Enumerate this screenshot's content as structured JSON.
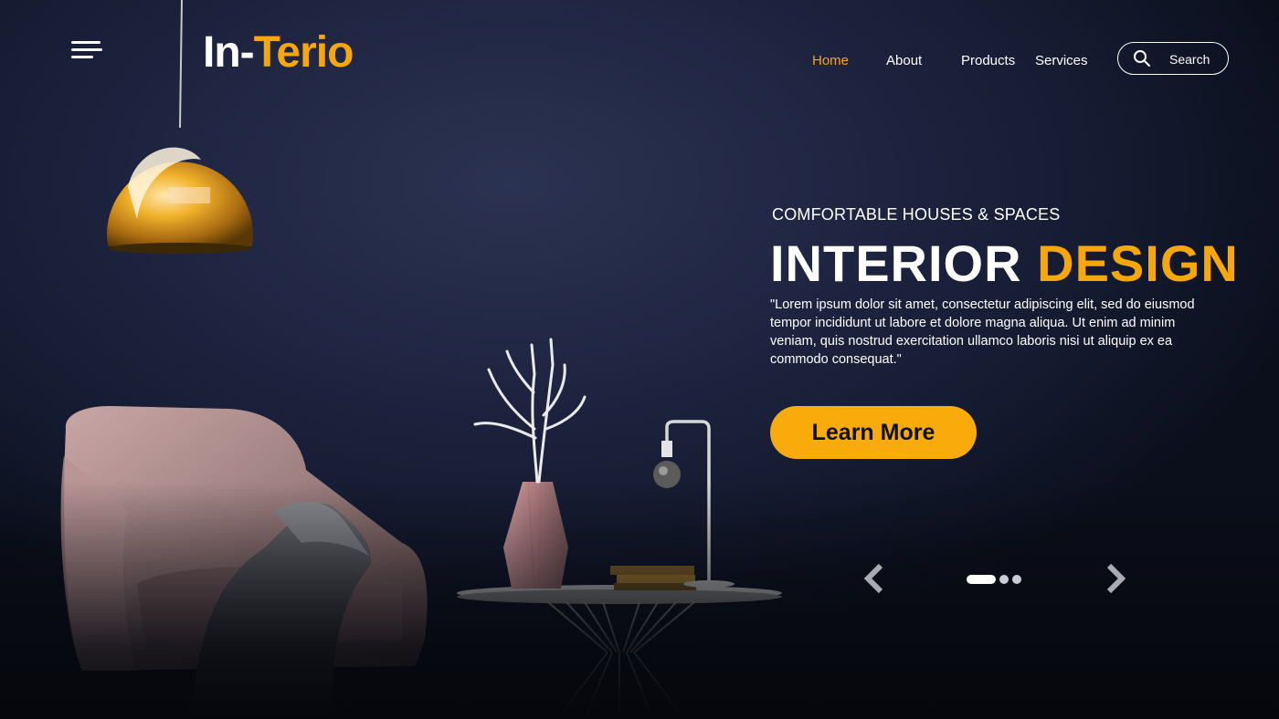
{
  "brand": {
    "part1": "In-",
    "part2": "Terio"
  },
  "nav": {
    "items": [
      {
        "label": "Home",
        "active": true
      },
      {
        "label": "About"
      },
      {
        "label": "Products"
      },
      {
        "label": "Services"
      }
    ]
  },
  "search": {
    "label": "Search"
  },
  "hero": {
    "kicker": "COMFORTABLE HOUSES & SPACES",
    "title_white": "INTERIOR",
    "title_accent": "DESIGN",
    "description": "\"Lorem ipsum dolor sit amet, consectetur adipiscing elit, sed do eiusmod tempor incididunt ut labore et dolore magna aliqua. Ut enim ad minim veniam, quis nostrud exercitation ullamco laboris nisi ut aliquip ex ea commodo consequat.\"",
    "cta_label": "Learn More"
  },
  "carousel": {
    "slide_count": 3,
    "active_slide": 1
  },
  "colors": {
    "accent": "#f5a70b",
    "background": "#1e2440",
    "text": "#ffffff"
  },
  "icons": [
    "menu-icon",
    "search-icon",
    "chevron-left-icon",
    "chevron-right-icon"
  ]
}
